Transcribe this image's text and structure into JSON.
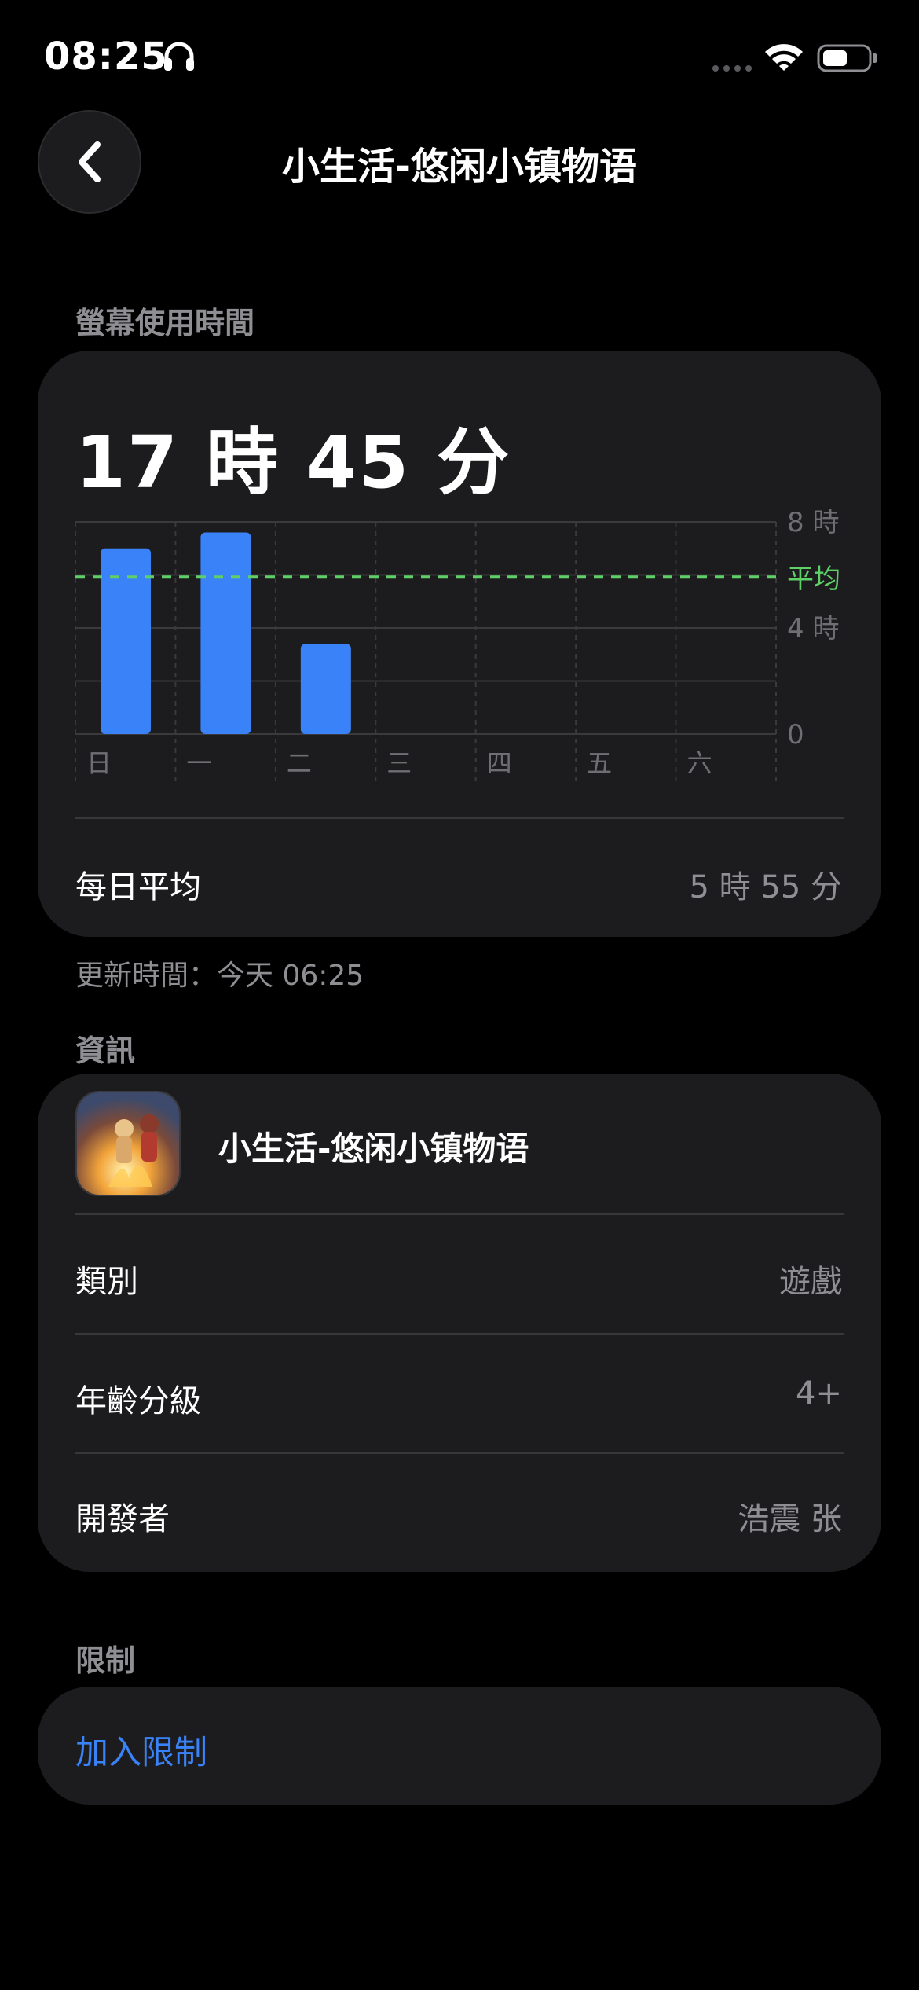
{
  "status_bar": {
    "time": "08:25"
  },
  "nav": {
    "title": "小生活-悠闲小镇物语"
  },
  "screen_time": {
    "section_label": "螢幕使用時間",
    "total": "17 時 45 分",
    "daily_avg_label": "每日平均",
    "daily_avg_value": "5 時 55 分",
    "updated": "更新時間：今天 06:25"
  },
  "chart_data": {
    "type": "bar",
    "categories": [
      "日",
      "一",
      "二",
      "三",
      "四",
      "五",
      "六"
    ],
    "values": [
      7.0,
      7.6,
      3.4,
      0,
      0,
      0,
      0
    ],
    "ylim": [
      0,
      8
    ],
    "yticks": [
      {
        "value": 8,
        "label": "8 時"
      },
      {
        "value": 4,
        "label": "4 時"
      },
      {
        "value": 0,
        "label": "0"
      }
    ],
    "average": {
      "value": 5.92,
      "label": "平均"
    },
    "bar_color": "#3a82f7",
    "average_color": "#5fd068"
  },
  "info": {
    "section_label": "資訊",
    "app_name": "小生活-悠闲小镇物语",
    "rows": [
      {
        "label": "類別",
        "value": "遊戲"
      },
      {
        "label": "年齡分級",
        "value": "4+"
      },
      {
        "label": "開發者",
        "value": "浩震 张"
      }
    ]
  },
  "limits": {
    "section_label": "限制",
    "add_label": "加入限制"
  }
}
